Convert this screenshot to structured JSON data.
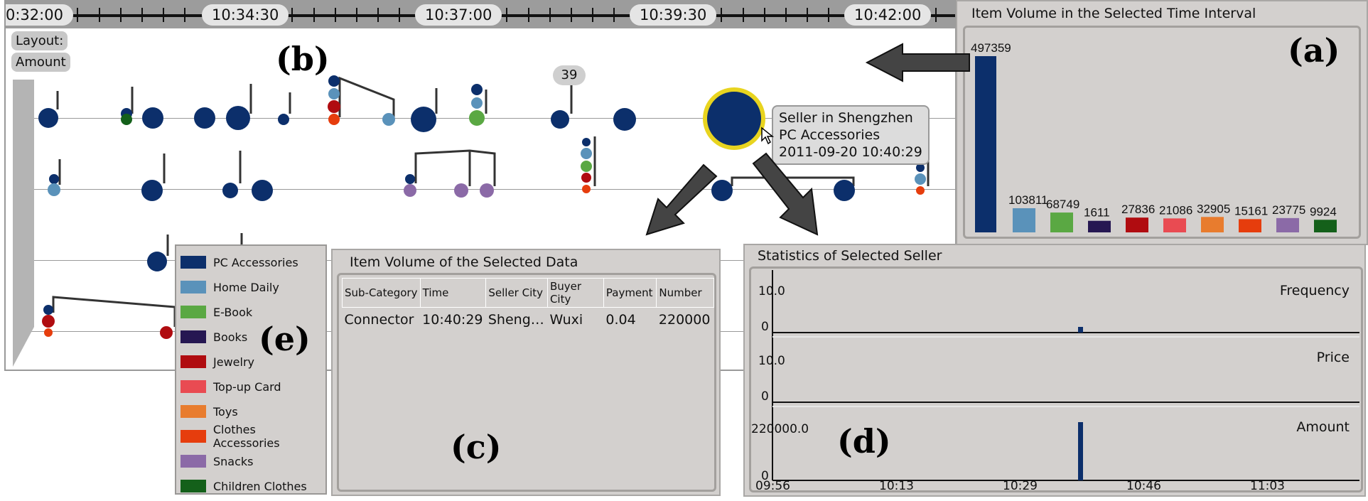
{
  "timeline": {
    "time_labels": [
      "0:32:00",
      "10:34:30",
      "10:37:00",
      "10:39:30",
      "10:42:00"
    ],
    "layout_label": "Layout:",
    "amount_label": "Amount",
    "count_badge": "39",
    "tooltip": [
      "Seller in Shengzhen",
      "PC Accessories",
      "2011-09-20 10:40:29"
    ]
  },
  "figure_labels": {
    "a": "(a)",
    "b": "(b)",
    "c": "(c)",
    "d": "(d)",
    "e": "(e)"
  },
  "categories": [
    {
      "name": "PC Accessories",
      "color": "#0c2f6b"
    },
    {
      "name": "Home Daily",
      "color": "#5a92ba"
    },
    {
      "name": "E-Book",
      "color": "#5aa843"
    },
    {
      "name": "Books",
      "color": "#261752"
    },
    {
      "name": "Jewelry",
      "color": "#b00c10"
    },
    {
      "name": "Top-up Card",
      "color": "#e94b52"
    },
    {
      "name": "Toys",
      "color": "#e87c2e"
    },
    {
      "name": "Clothes Accessories",
      "color": "#e63d0d"
    },
    {
      "name": "Snacks",
      "color": "#8b6aa7"
    },
    {
      "name": "Children Clothes",
      "color": "#14601a"
    }
  ],
  "volume_panel": {
    "title": "Item Volume in the Selected Time Interval",
    "chart_data": {
      "type": "bar",
      "categories": [
        "PC Accessories",
        "Home Daily",
        "E-Book",
        "Books",
        "Jewelry",
        "Top-up Card",
        "Toys",
        "Clothes Accessories",
        "Snacks",
        "Children Clothes"
      ],
      "values": [
        497359,
        103811,
        68749,
        1611,
        27836,
        21086,
        32905,
        15161,
        23775,
        9924
      ],
      "value_labels": [
        "497359",
        "103811",
        "68749",
        "1611",
        "27836",
        "21086",
        "32905",
        "15161",
        "23775",
        "9924"
      ]
    }
  },
  "selected_panel": {
    "title": "Item Volume of the Selected Data",
    "columns": [
      "Sub-Category",
      "Time",
      "Seller City",
      "Buyer City",
      "Payment",
      "Number"
    ],
    "rows": [
      [
        "Connector",
        "10:40:29",
        "Sheng…",
        "Wuxi",
        "0.04",
        "220000"
      ]
    ]
  },
  "seller_panel": {
    "title": "Statistics of Selected Seller",
    "charts": [
      {
        "label": "Frequency",
        "ymax": "10.0",
        "ymin": "0"
      },
      {
        "label": "Price",
        "ymax": "10.0",
        "ymin": "0"
      },
      {
        "label": "Amount",
        "ymax": "220000.0",
        "ymin": "0"
      }
    ],
    "x_ticks": [
      "09:56",
      "10:13",
      "10:29",
      "10:46",
      "11:03"
    ],
    "chart_data": {
      "type": "bar",
      "x": [
        "10:40:29"
      ],
      "series": [
        {
          "name": "Frequency",
          "values": [
            1
          ]
        },
        {
          "name": "Amount",
          "values": [
            220000
          ]
        }
      ]
    }
  }
}
